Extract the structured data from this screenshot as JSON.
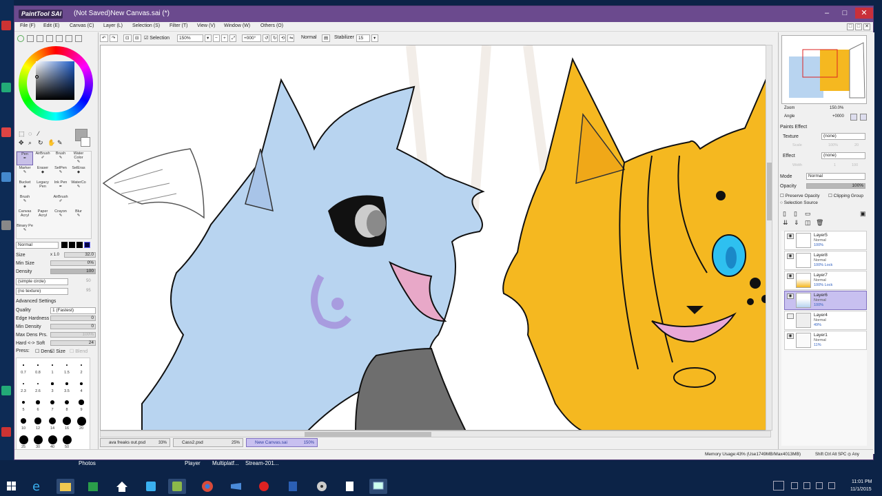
{
  "window": {
    "title": "(Not Saved)New Canvas.sai (*)",
    "app_logo": "PaintTool SAI",
    "min": "–",
    "max": "□",
    "close": "✕"
  },
  "menu": [
    "File (F)",
    "Edit (E)",
    "Canvas (C)",
    "Layer (L)",
    "Selection (S)",
    "Filter (T)",
    "View (V)",
    "Window (W)",
    "Others (O)"
  ],
  "toolbar": {
    "selection_label": "Selection",
    "zoom": "150%",
    "angle": "+000°",
    "blend": "Normal",
    "stabilizer_label": "Stabilizer",
    "stabilizer": "15"
  },
  "tools": [
    [
      "Pen",
      "AirBrush",
      "Brush",
      "Water Color"
    ],
    [
      "Marker",
      "Eraser",
      "SelPen",
      "SelEras"
    ],
    [
      "Bucket",
      "Legacy Pen",
      "Ink Pen",
      "WaterCo"
    ],
    [
      "Brush",
      "",
      "AirBrush",
      ""
    ],
    [
      "Canvas Acryl",
      "Paper Acryl",
      "Crayon",
      "Blur"
    ],
    [
      "Binary Pe",
      "",
      "",
      ""
    ]
  ],
  "brush": {
    "mode": "Normal",
    "size_label": "Size",
    "size_mult": "x 1.0",
    "size": "32.0",
    "min_size_label": "Min Size",
    "min_size": "0%",
    "density_label": "Density",
    "density": "100",
    "shape": "(simple circle)",
    "shape_val": "50",
    "texture": "(no texture)",
    "texture_val": "95",
    "advanced": "Advanced Settings",
    "quality_label": "Quality",
    "quality": "1 (Fastest)",
    "edge_label": "Edge Hardness",
    "edge": "0",
    "min_density_label": "Min Density",
    "min_density": "0",
    "max_dens_label": "Max Dens Prs.",
    "max_dens": "100%",
    "hard_soft_label": "Hard <-> Soft",
    "hard_soft": "24",
    "press_label": "Press:",
    "dens": "Dens",
    "size_chk": "Size",
    "blend_chk": "Blend"
  },
  "brush_sizes": [
    "0.7",
    "0.8",
    "1",
    "1.5",
    "2",
    "2.3",
    "2.6",
    "3",
    "3.5",
    "4",
    "5",
    "6",
    "7",
    "8",
    "9",
    "10",
    "12",
    "14",
    "16",
    "20",
    "25",
    "30",
    "40",
    "50"
  ],
  "navigator": {
    "zoom_label": "Zoom",
    "zoom": "150.0%",
    "angle_label": "Angle",
    "angle": "+0000"
  },
  "paints_effect": {
    "header": "Paints Effect",
    "texture_label": "Texture",
    "texture": "(none)",
    "effect_label": "Effect",
    "effect": "(none)",
    "scale": "Scale",
    "scale_val": "100%",
    "scale_num": "20",
    "width": "Width",
    "width_val": "1",
    "width_num": "100"
  },
  "layer_props": {
    "mode_label": "Mode",
    "mode": "Normal",
    "opacity_label": "Opacity",
    "opacity": "100%",
    "preserve": "Preserve Opacity",
    "clipping": "Clipping Group",
    "selection_source": "Selection Source"
  },
  "layers": [
    {
      "name": "Layer5",
      "mode": "Normal",
      "op": "100%"
    },
    {
      "name": "Layer8",
      "mode": "Normal",
      "op": "100% Lock"
    },
    {
      "name": "Layer7",
      "mode": "Normal",
      "op": "100% Lock"
    },
    {
      "name": "Layer6",
      "mode": "Normal",
      "op": "100%"
    },
    {
      "name": "Layer4",
      "mode": "Normal",
      "op": "49%"
    },
    {
      "name": "Layer1",
      "mode": "Normal",
      "op": "11%"
    }
  ],
  "tabs": [
    {
      "name": "ava freaks out.psd",
      "pct": "33%"
    },
    {
      "name": "Cass2.psd",
      "pct": "25%"
    },
    {
      "name": "New Canvas.sai",
      "pct": "150%"
    }
  ],
  "status": {
    "memory": "Memory Usage:43% (Use1749MB/Max4013MB)",
    "keys": "Shift Ctrl Alt SPC ◎ Any"
  },
  "desktop_labels": [
    "Photos",
    "Player",
    "Multiplatf...",
    "Stream-201..."
  ],
  "clock": {
    "time": "11:01 PM",
    "date": "11/1/2015"
  },
  "colors": {
    "title": "#6b4a8e",
    "wolf": "#b8d4f0",
    "cat": "#f5b820",
    "accent": "#c8c0f0"
  }
}
